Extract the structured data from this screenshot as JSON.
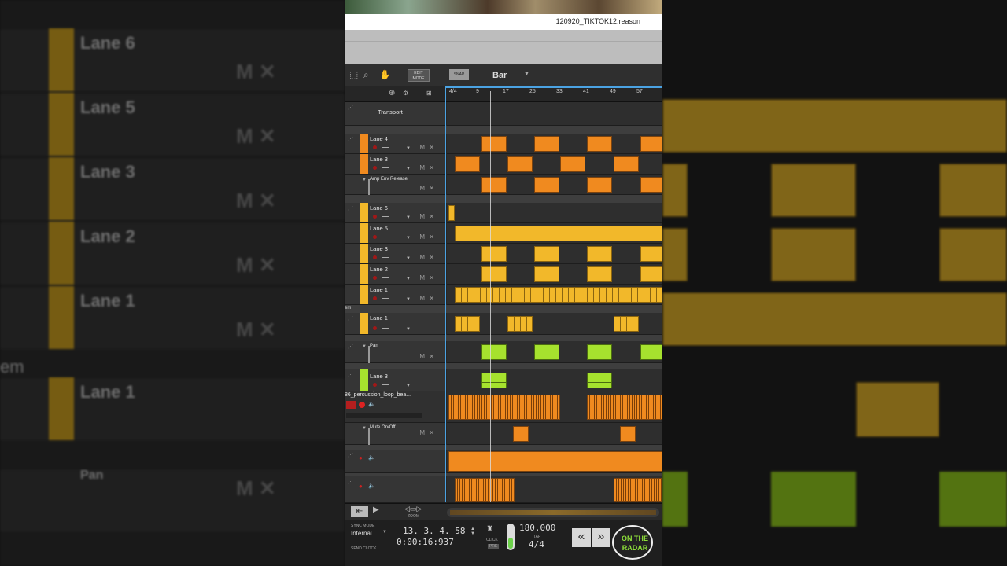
{
  "window": {
    "title": "120920_TIKTOK12.reason"
  },
  "toolbar": {
    "edit_mode_label": "EDIT MODE",
    "snap_label": "SNAP",
    "snap_value": "Bar"
  },
  "ruler": {
    "ticks": [
      "4/4",
      "9",
      "17",
      "25",
      "33",
      "41",
      "49",
      "57"
    ]
  },
  "tracks": {
    "transport": "Transport",
    "lane4": "Lane 4",
    "lane3a": "Lane 3",
    "amp_env": "Amp Env Release",
    "lane6": "Lane 6",
    "lane5": "Lane 5",
    "lane3b": "Lane 3",
    "lane2": "Lane 2",
    "lane1a": "Lane 1",
    "group_tail": "em",
    "lane1b": "Lane 1",
    "pan": "Pan",
    "lane3c": "Lane 3",
    "audio_track": "86_percussion_loop_bea...",
    "mute": "Mute On/Off"
  },
  "controls": {
    "m": "M",
    "x": "✕"
  },
  "bottom": {
    "zoom_label": "ZOOM",
    "sync_mode_label": "SYNC MODE",
    "sync_mode_value": "Internal",
    "send_clock": "SEND CLOCK",
    "position_bars": "13. 3. 4. 58",
    "position_time": "0:00:16:937",
    "click_label": "CLICK",
    "pre_label": "PRE",
    "tempo": "180.000",
    "tap_label": "TAP",
    "signature": "4/4"
  },
  "watermark": {
    "line1": "ON THE",
    "line2": "RADAR"
  },
  "background_echo": {
    "lanes": [
      "Lane 6",
      "Lane 5",
      "Lane 3",
      "Lane 2",
      "Lane 1",
      "em",
      "Lane 1",
      "Pan"
    ]
  },
  "colors": {
    "orange": "#f08a1f",
    "amber": "#f2b82a",
    "green": "#a6e22e",
    "loop": "#4ba3e3"
  }
}
